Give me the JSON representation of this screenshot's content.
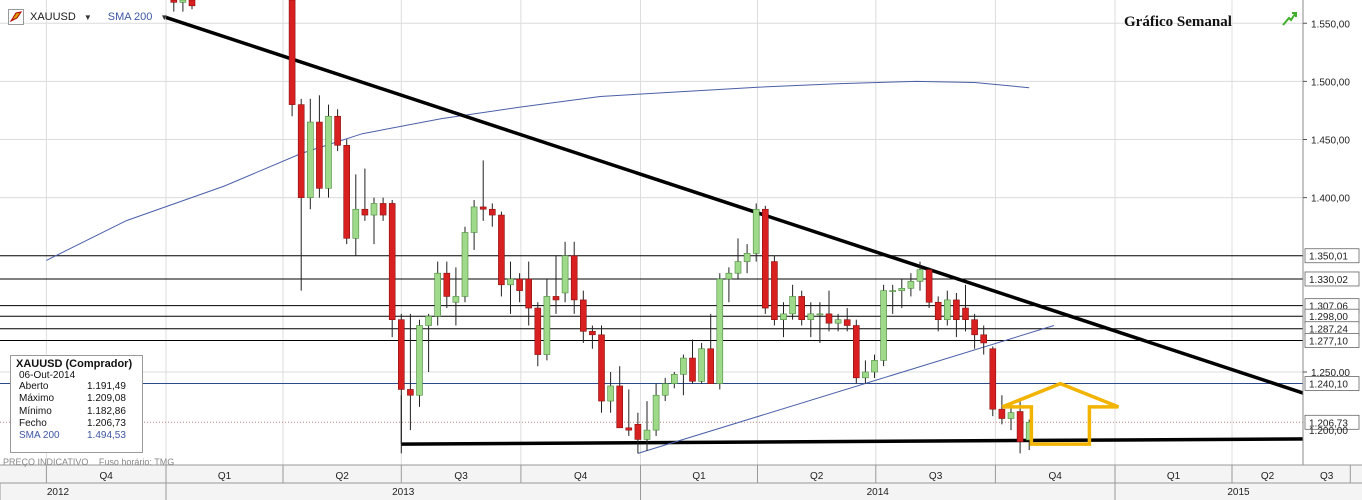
{
  "toolbar": {
    "symbol": "XAUUSD",
    "indicator": "SMA 200"
  },
  "title": "Gráfico Semanal",
  "info_box": {
    "title": "XAUUSD (Comprador)",
    "date": "06-Out-2014",
    "rows": [
      {
        "label": "Aberto",
        "value": "1.191,49"
      },
      {
        "label": "Máximo",
        "value": "1.209,08"
      },
      {
        "label": "Mínimo",
        "value": "1.182,86"
      },
      {
        "label": "Fecho",
        "value": "1.206,73"
      },
      {
        "label": "SMA 200",
        "value": "1.494,53"
      }
    ]
  },
  "footnote": {
    "note": "PREÇO INDICATIVO",
    "tz": "Fuso horário: TMG"
  },
  "colors": {
    "up": "#9fd98a",
    "down": "#d92020",
    "sma": "#4a5fa8",
    "trend": "#000000",
    "arrow": "#f2b400",
    "level": "#000000",
    "price_line": "#2a4a8c"
  },
  "chart_data": {
    "type": "candlestick",
    "symbol": "XAUUSD",
    "period": "weekly",
    "ylim": [
      1170,
      1570
    ],
    "y_ticks": [
      "1.550,00",
      "1.500,00",
      "1.450,00",
      "1.400,00",
      "1.250,00"
    ],
    "levels": [
      {
        "value": 1350.01,
        "label": "1.350,01"
      },
      {
        "value": 1330.02,
        "label": "1.330,02"
      },
      {
        "value": 1307.06,
        "label": "1.307,06"
      },
      {
        "value": 1298.0,
        "label": "1.298,00"
      },
      {
        "value": 1287.24,
        "label": "1.287,24"
      },
      {
        "value": 1277.1,
        "label": "1.277,10"
      },
      {
        "value": 1240.1,
        "label": "1.240,10",
        "color": "blue"
      },
      {
        "value": 1206.73,
        "label": "1.206,73",
        "dotted": true,
        "red": true
      },
      {
        "value": 1200.0,
        "label": "1.200,00"
      }
    ],
    "quarters": [
      {
        "label": "Q4",
        "start": "2012-10-01"
      },
      {
        "label": "Q1",
        "start": "2013-01-01"
      },
      {
        "label": "Q2",
        "start": "2013-04-01"
      },
      {
        "label": "Q3",
        "start": "2013-07-01"
      },
      {
        "label": "Q4",
        "start": "2013-10-01"
      },
      {
        "label": "Q1",
        "start": "2014-01-01"
      },
      {
        "label": "Q2",
        "start": "2014-04-01"
      },
      {
        "label": "Q3",
        "start": "2014-07-01"
      },
      {
        "label": "Q4",
        "start": "2014-10-01"
      },
      {
        "label": "Q1",
        "start": "2015-01-01"
      },
      {
        "label": "Q2",
        "start": "2015-04-01"
      },
      {
        "label": "Q3",
        "start": "2015-07-01"
      }
    ],
    "years": [
      {
        "label": "2012",
        "start": "2012-07-01"
      },
      {
        "label": "2013",
        "start": "2013-01-01"
      },
      {
        "label": "2014",
        "start": "2014-01-01"
      },
      {
        "label": "2015",
        "start": "2015-01-01"
      }
    ],
    "candles": [
      {
        "t": "2013-01-07",
        "o": 1570,
        "h": 1575,
        "l": 1560,
        "c": 1568
      },
      {
        "t": "2013-01-14",
        "o": 1568,
        "h": 1575,
        "l": 1560,
        "c": 1570
      },
      {
        "t": "2013-01-21",
        "o": 1570,
        "h": 1575,
        "l": 1562,
        "c": 1565
      },
      {
        "t": "2013-04-08",
        "o": 1570,
        "h": 1578,
        "l": 1470,
        "c": 1480
      },
      {
        "t": "2013-04-15",
        "o": 1480,
        "h": 1485,
        "l": 1320,
        "c": 1400
      },
      {
        "t": "2013-04-22",
        "o": 1400,
        "h": 1485,
        "l": 1390,
        "c": 1465
      },
      {
        "t": "2013-04-29",
        "o": 1465,
        "h": 1488,
        "l": 1400,
        "c": 1408
      },
      {
        "t": "2013-05-06",
        "o": 1408,
        "h": 1480,
        "l": 1400,
        "c": 1470
      },
      {
        "t": "2013-05-13",
        "o": 1470,
        "h": 1476,
        "l": 1440,
        "c": 1445
      },
      {
        "t": "2013-05-20",
        "o": 1445,
        "h": 1450,
        "l": 1360,
        "c": 1365
      },
      {
        "t": "2013-05-27",
        "o": 1365,
        "h": 1420,
        "l": 1350,
        "c": 1390
      },
      {
        "t": "2013-06-03",
        "o": 1390,
        "h": 1425,
        "l": 1380,
        "c": 1385
      },
      {
        "t": "2013-06-10",
        "o": 1385,
        "h": 1400,
        "l": 1360,
        "c": 1395
      },
      {
        "t": "2013-06-17",
        "o": 1395,
        "h": 1400,
        "l": 1380,
        "c": 1385
      },
      {
        "t": "2013-06-24",
        "o": 1395,
        "h": 1398,
        "l": 1280,
        "c": 1295
      },
      {
        "t": "2013-07-01",
        "o": 1295,
        "h": 1300,
        "l": 1180,
        "c": 1235
      },
      {
        "t": "2013-07-08",
        "o": 1235,
        "h": 1300,
        "l": 1200,
        "c": 1230
      },
      {
        "t": "2013-07-15",
        "o": 1230,
        "h": 1295,
        "l": 1220,
        "c": 1290
      },
      {
        "t": "2013-07-22",
        "o": 1290,
        "h": 1300,
        "l": 1250,
        "c": 1298
      },
      {
        "t": "2013-07-29",
        "o": 1298,
        "h": 1345,
        "l": 1290,
        "c": 1335
      },
      {
        "t": "2013-08-05",
        "o": 1335,
        "h": 1345,
        "l": 1305,
        "c": 1315
      },
      {
        "t": "2013-08-12",
        "o": 1310,
        "h": 1340,
        "l": 1290,
        "c": 1315
      },
      {
        "t": "2013-08-19",
        "o": 1315,
        "h": 1375,
        "l": 1310,
        "c": 1370
      },
      {
        "t": "2013-08-26",
        "o": 1370,
        "h": 1398,
        "l": 1355,
        "c": 1392
      },
      {
        "t": "2013-09-02",
        "o": 1392,
        "h": 1432,
        "l": 1380,
        "c": 1390
      },
      {
        "t": "2013-09-09",
        "o": 1390,
        "h": 1395,
        "l": 1375,
        "c": 1385
      },
      {
        "t": "2013-09-16",
        "o": 1385,
        "h": 1388,
        "l": 1315,
        "c": 1325
      },
      {
        "t": "2013-09-23",
        "o": 1325,
        "h": 1345,
        "l": 1300,
        "c": 1330
      },
      {
        "t": "2013-09-30",
        "o": 1330,
        "h": 1335,
        "l": 1310,
        "c": 1320
      },
      {
        "t": "2013-10-07",
        "o": 1330,
        "h": 1345,
        "l": 1290,
        "c": 1305
      },
      {
        "t": "2013-10-14",
        "o": 1305,
        "h": 1310,
        "l": 1255,
        "c": 1265
      },
      {
        "t": "2013-10-21",
        "o": 1265,
        "h": 1330,
        "l": 1260,
        "c": 1315
      },
      {
        "t": "2013-10-28",
        "o": 1315,
        "h": 1350,
        "l": 1300,
        "c": 1312
      },
      {
        "t": "2013-11-04",
        "o": 1318,
        "h": 1362,
        "l": 1310,
        "c": 1350
      },
      {
        "t": "2013-11-11",
        "o": 1350,
        "h": 1362,
        "l": 1300,
        "c": 1312
      },
      {
        "t": "2013-11-18",
        "o": 1312,
        "h": 1320,
        "l": 1275,
        "c": 1285
      },
      {
        "t": "2013-11-25",
        "o": 1285,
        "h": 1290,
        "l": 1270,
        "c": 1282
      },
      {
        "t": "2013-12-02",
        "o": 1282,
        "h": 1290,
        "l": 1215,
        "c": 1225
      },
      {
        "t": "2013-12-09",
        "o": 1225,
        "h": 1250,
        "l": 1215,
        "c": 1238
      },
      {
        "t": "2013-12-16",
        "o": 1238,
        "h": 1255,
        "l": 1215,
        "c": 1202
      },
      {
        "t": "2013-12-23",
        "o": 1202,
        "h": 1235,
        "l": 1195,
        "c": 1200
      },
      {
        "t": "2013-12-30",
        "o": 1205,
        "h": 1215,
        "l": 1180,
        "c": 1192
      },
      {
        "t": "2014-01-06",
        "o": 1192,
        "h": 1225,
        "l": 1182,
        "c": 1200
      },
      {
        "t": "2014-01-13",
        "o": 1200,
        "h": 1240,
        "l": 1195,
        "c": 1230
      },
      {
        "t": "2014-01-20",
        "o": 1230,
        "h": 1245,
        "l": 1225,
        "c": 1240
      },
      {
        "t": "2014-01-27",
        "o": 1240,
        "h": 1250,
        "l": 1236,
        "c": 1248
      },
      {
        "t": "2014-02-03",
        "o": 1248,
        "h": 1265,
        "l": 1230,
        "c": 1262
      },
      {
        "t": "2014-02-10",
        "o": 1262,
        "h": 1278,
        "l": 1240,
        "c": 1242
      },
      {
        "t": "2014-02-17",
        "o": 1242,
        "h": 1275,
        "l": 1240,
        "c": 1270
      },
      {
        "t": "2014-02-24",
        "o": 1270,
        "h": 1300,
        "l": 1265,
        "c": 1240
      },
      {
        "t": "2014-03-03",
        "o": 1240,
        "h": 1335,
        "l": 1235,
        "c": 1330
      },
      {
        "t": "2014-03-10",
        "o": 1330,
        "h": 1340,
        "l": 1310,
        "c": 1335
      },
      {
        "t": "2014-03-17",
        "o": 1335,
        "h": 1365,
        "l": 1330,
        "c": 1345
      },
      {
        "t": "2014-03-24",
        "o": 1345,
        "h": 1360,
        "l": 1335,
        "c": 1352
      },
      {
        "t": "2014-03-31",
        "o": 1352,
        "h": 1395,
        "l": 1345,
        "c": 1390
      },
      {
        "t": "2014-04-07",
        "o": 1390,
        "h": 1393,
        "l": 1300,
        "c": 1305
      },
      {
        "t": "2014-04-14",
        "o": 1345,
        "h": 1350,
        "l": 1290,
        "c": 1295
      },
      {
        "t": "2014-04-21",
        "o": 1295,
        "h": 1310,
        "l": 1280,
        "c": 1300
      },
      {
        "t": "2014-04-28",
        "o": 1300,
        "h": 1325,
        "l": 1295,
        "c": 1315
      },
      {
        "t": "2014-05-05",
        "o": 1315,
        "h": 1320,
        "l": 1290,
        "c": 1295
      },
      {
        "t": "2014-05-12",
        "o": 1295,
        "h": 1310,
        "l": 1280,
        "c": 1300
      },
      {
        "t": "2014-05-19",
        "o": 1300,
        "h": 1310,
        "l": 1275,
        "c": 1300
      },
      {
        "t": "2014-05-26",
        "o": 1300,
        "h": 1320,
        "l": 1285,
        "c": 1292
      },
      {
        "t": "2014-06-02",
        "o": 1292,
        "h": 1300,
        "l": 1285,
        "c": 1295
      },
      {
        "t": "2014-06-09",
        "o": 1295,
        "h": 1305,
        "l": 1285,
        "c": 1290
      },
      {
        "t": "2014-06-16",
        "o": 1290,
        "h": 1295,
        "l": 1240,
        "c": 1245
      },
      {
        "t": "2014-06-23",
        "o": 1245,
        "h": 1260,
        "l": 1240,
        "c": 1250
      },
      {
        "t": "2014-06-30",
        "o": 1250,
        "h": 1265,
        "l": 1245,
        "c": 1260
      },
      {
        "t": "2014-07-07",
        "o": 1260,
        "h": 1325,
        "l": 1255,
        "c": 1320
      },
      {
        "t": "2014-07-14",
        "o": 1320,
        "h": 1325,
        "l": 1300,
        "c": 1320
      },
      {
        "t": "2014-07-21",
        "o": 1320,
        "h": 1330,
        "l": 1305,
        "c": 1322
      },
      {
        "t": "2014-07-28",
        "o": 1322,
        "h": 1335,
        "l": 1315,
        "c": 1328
      },
      {
        "t": "2014-08-04",
        "o": 1328,
        "h": 1345,
        "l": 1320,
        "c": 1338
      },
      {
        "t": "2014-08-11",
        "o": 1338,
        "h": 1340,
        "l": 1305,
        "c": 1310
      },
      {
        "t": "2014-08-18",
        "o": 1310,
        "h": 1315,
        "l": 1285,
        "c": 1295
      },
      {
        "t": "2014-08-25",
        "o": 1295,
        "h": 1320,
        "l": 1290,
        "c": 1312
      },
      {
        "t": "2014-09-01",
        "o": 1312,
        "h": 1318,
        "l": 1280,
        "c": 1295
      },
      {
        "t": "2014-09-08",
        "o": 1305,
        "h": 1325,
        "l": 1285,
        "c": 1295
      },
      {
        "t": "2014-09-15",
        "o": 1295,
        "h": 1300,
        "l": 1270,
        "c": 1282
      },
      {
        "t": "2014-09-22",
        "o": 1282,
        "h": 1290,
        "l": 1265,
        "c": 1275
      },
      {
        "t": "2014-09-29",
        "o": 1270,
        "h": 1272,
        "l": 1212,
        "c": 1218
      },
      {
        "t": "2014-10-06",
        "o": 1218,
        "h": 1230,
        "l": 1205,
        "c": 1210
      },
      {
        "t": "2014-10-13",
        "o": 1210,
        "h": 1220,
        "l": 1200,
        "c": 1215
      },
      {
        "t": "2014-10-20",
        "o": 1216,
        "h": 1225,
        "l": 1180,
        "c": 1190
      },
      {
        "t": "2014-10-27",
        "o": 1191.49,
        "h": 1209.08,
        "l": 1182.86,
        "c": 1206.73
      }
    ],
    "sma200": [
      {
        "t": "2012-10-01",
        "v": 1346
      },
      {
        "t": "2012-12-01",
        "v": 1380
      },
      {
        "t": "2013-02-15",
        "v": 1410
      },
      {
        "t": "2013-04-15",
        "v": 1438
      },
      {
        "t": "2013-06-01",
        "v": 1455
      },
      {
        "t": "2013-08-01",
        "v": 1468
      },
      {
        "t": "2013-10-01",
        "v": 1478
      },
      {
        "t": "2013-12-01",
        "v": 1487
      },
      {
        "t": "2014-01-15",
        "v": 1490
      },
      {
        "t": "2014-04-01",
        "v": 1495
      },
      {
        "t": "2014-06-01",
        "v": 1498
      },
      {
        "t": "2014-08-01",
        "v": 1500
      },
      {
        "t": "2014-09-15",
        "v": 1499
      },
      {
        "t": "2014-10-27",
        "v": 1494.53
      }
    ],
    "trendlines": [
      {
        "from": {
          "t": "2013-01-01",
          "v": 1555
        },
        "to": {
          "t": "2015-08-20",
          "v": 1200
        }
      },
      {
        "from": {
          "t": "2013-07-01",
          "v": 1188
        },
        "to": {
          "t": "2015-08-20",
          "v": 1193
        }
      },
      {
        "from": {
          "t": "2013-07-01",
          "v": 1188
        },
        "to": {
          "t": "2013-07-01",
          "v": 1230
        }
      },
      {
        "from": {
          "t": "2013-12-30",
          "v": 1180
        },
        "to": {
          "t": "2014-11-15",
          "v": 1290
        }
      }
    ],
    "arrow": {
      "t": "2014-11-20",
      "low": 1188,
      "high": 1240,
      "dir": "up"
    }
  }
}
